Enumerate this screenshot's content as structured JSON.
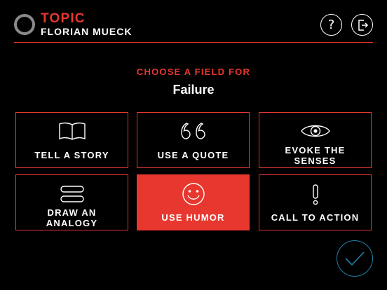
{
  "header": {
    "label": "TOPIC",
    "author": "FLORIAN MUECK",
    "help_glyph": "?",
    "help_icon": "question-icon",
    "exit_icon": "exit-icon"
  },
  "prompt": {
    "instruction": "CHOOSE A FIELD FOR",
    "topic": "Failure"
  },
  "fields": [
    {
      "label": "TELL A STORY",
      "icon": "book-icon",
      "selected": false
    },
    {
      "label": "USE A QUOTE",
      "icon": "quote-icon",
      "selected": false
    },
    {
      "label": "EVOKE THE\nSENSES",
      "icon": "eye-icon",
      "selected": false
    },
    {
      "label": "DRAW AN\nANALOGY",
      "icon": "equals-icon",
      "selected": false
    },
    {
      "label": "USE HUMOR",
      "icon": "smiley-icon",
      "selected": true
    },
    {
      "label": "CALL TO ACTION",
      "icon": "exclamation-icon",
      "selected": false
    }
  ],
  "confirm": {
    "icon": "checkmark-icon"
  },
  "colors": {
    "accent": "#e8372f",
    "background": "#000000",
    "text": "#ffffff",
    "confirm_ring": "#1f7fa6"
  }
}
